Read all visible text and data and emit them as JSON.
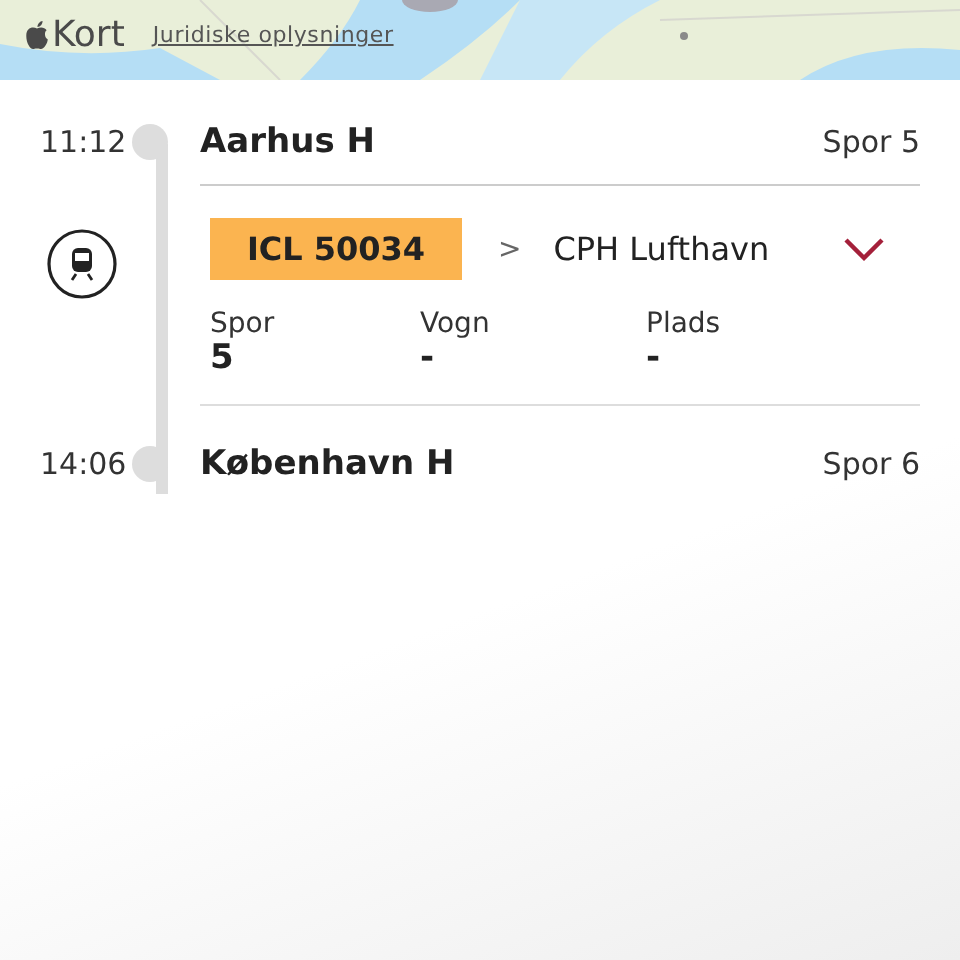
{
  "map": {
    "brand": "Kort",
    "legal_link": "Juridiske oplysninger"
  },
  "departure": {
    "time": "11:12",
    "station": "Aarhus H",
    "track": "Spor 5"
  },
  "train": {
    "number": "ICL 50034",
    "separator": ">",
    "destination": "CPH Lufthavn",
    "expanded": true,
    "details": [
      {
        "label": "Spor",
        "value": "5"
      },
      {
        "label": "Vogn",
        "value": "-"
      },
      {
        "label": "Plads",
        "value": "-"
      }
    ]
  },
  "arrival": {
    "time": "14:06",
    "station": "København H",
    "track": "Spor 6"
  }
}
